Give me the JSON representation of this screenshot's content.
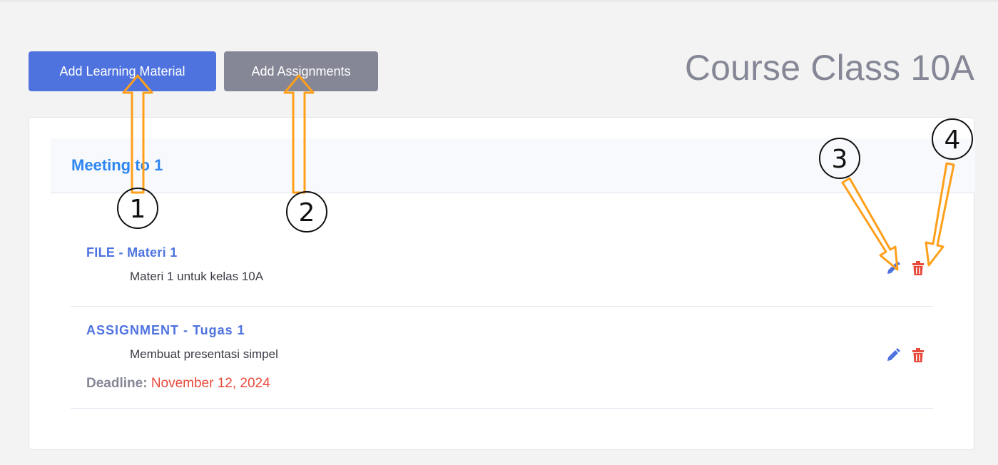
{
  "toolbar": {
    "add_material_label": "Add Learning Material",
    "add_assignments_label": "Add Assignments"
  },
  "page": {
    "title": "Course Class 10A"
  },
  "meeting": {
    "title": "Meeting to 1",
    "items": [
      {
        "title": "FILE - Materi 1",
        "description": "Materi 1 untuk kelas 10A"
      },
      {
        "title": "ASSIGNMENT - Tugas 1",
        "description": "Membuat presentasi simpel",
        "deadline_label": "Deadline:",
        "deadline_value": "November 12, 2024"
      }
    ]
  },
  "annotations": {
    "n1": "1",
    "n2": "2",
    "n3": "3",
    "n4": "4"
  },
  "icons": {
    "edit": "pencil-icon",
    "delete": "trash-icon"
  },
  "colors": {
    "primary": "#4e73df",
    "secondary": "#858796",
    "danger": "#e74a3b",
    "meeting_title": "#2e86f0",
    "annotation_arrow": "#ff9f1a"
  }
}
